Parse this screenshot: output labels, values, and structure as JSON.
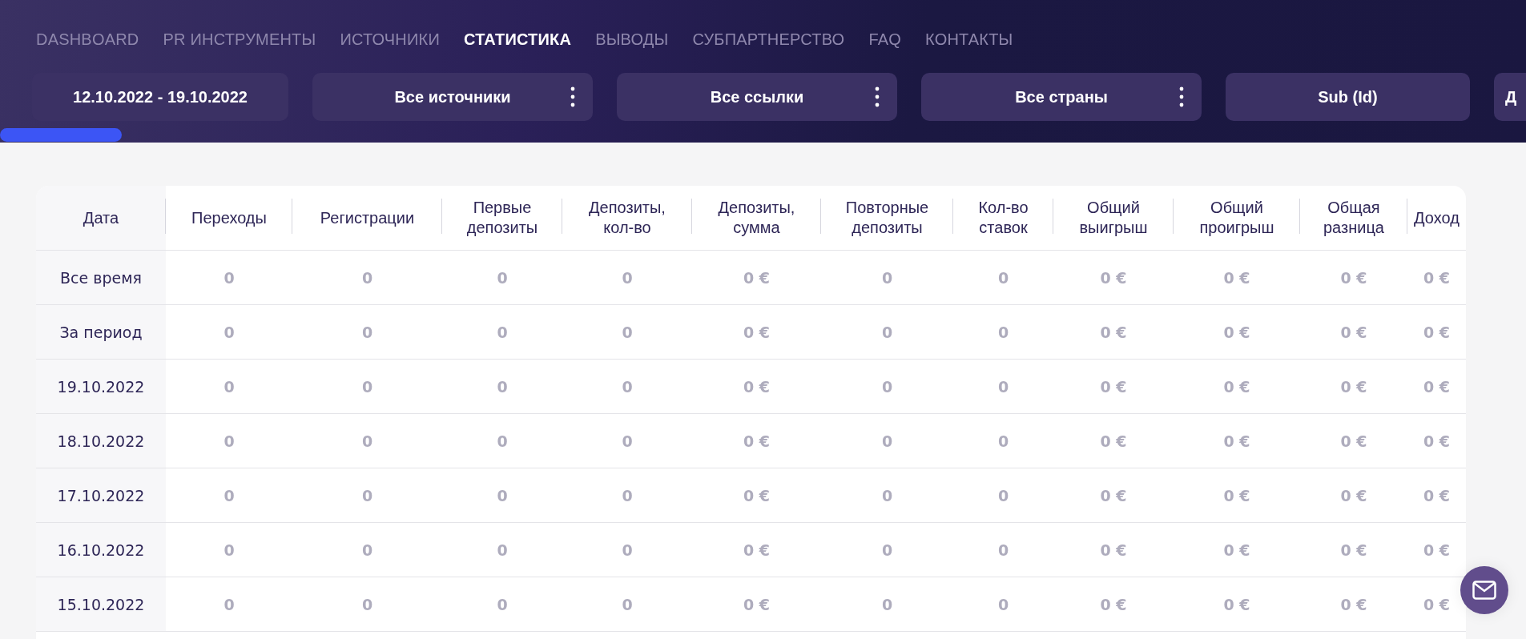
{
  "nav": [
    {
      "label": "DASHBOARD",
      "selected": false
    },
    {
      "label": "PR ИНСТРУМЕНТЫ",
      "selected": false
    },
    {
      "label": "ИСТОЧНИКИ",
      "selected": false
    },
    {
      "label": "СТАТИСТИКА",
      "selected": true
    },
    {
      "label": "ВЫВОДЫ",
      "selected": false
    },
    {
      "label": "СУБПАРТНЕРСТВО",
      "selected": false
    },
    {
      "label": "FAQ",
      "selected": false
    },
    {
      "label": "КОНТАКТЫ",
      "selected": false
    }
  ],
  "filters": [
    {
      "label": "12.10.2022 - 19.10.2022",
      "has_menu": false
    },
    {
      "label": "Все источники",
      "has_menu": true
    },
    {
      "label": "Все ссылки",
      "has_menu": true
    },
    {
      "label": "Все страны",
      "has_menu": true
    },
    {
      "label": "Sub (Id)",
      "has_menu": false
    },
    {
      "label": "Д",
      "has_menu": false
    }
  ],
  "loading": {
    "level": 0.08
  },
  "table": {
    "columns": [
      "Дата",
      "Переходы",
      "Регистрации",
      "Первые депозиты",
      "Депозиты, кол-во",
      "Депозиты, сумма",
      "Повторные депозиты",
      "Кол-во ставок",
      "Общий выигрыш",
      "Общий проигрыш",
      "Общая разница",
      "Доход"
    ],
    "rows": [
      {
        "cells": [
          "Все время",
          "0",
          "0",
          "0",
          "0",
          "0 €",
          "0",
          "0",
          "0 €",
          "0 €",
          "0 €",
          "0 €"
        ]
      },
      {
        "cells": [
          "За период",
          "0",
          "0",
          "0",
          "0",
          "0 €",
          "0",
          "0",
          "0 €",
          "0 €",
          "0 €",
          "0 €"
        ]
      },
      {
        "cells": [
          "19.10.2022",
          "0",
          "0",
          "0",
          "0",
          "0 €",
          "0",
          "0",
          "0 €",
          "0 €",
          "0 €",
          "0 €"
        ]
      },
      {
        "cells": [
          "18.10.2022",
          "0",
          "0",
          "0",
          "0",
          "0 €",
          "0",
          "0",
          "0 €",
          "0 €",
          "0 €",
          "0 €"
        ]
      },
      {
        "cells": [
          "17.10.2022",
          "0",
          "0",
          "0",
          "0",
          "0 €",
          "0",
          "0",
          "0 €",
          "0 €",
          "0 €",
          "0 €"
        ]
      },
      {
        "cells": [
          "16.10.2022",
          "0",
          "0",
          "0",
          "0",
          "0 €",
          "0",
          "0",
          "0 €",
          "0 €",
          "0 €",
          "0 €"
        ]
      },
      {
        "cells": [
          "15.10.2022",
          "0",
          "0",
          "0",
          "0",
          "0 €",
          "0",
          "0",
          "0 €",
          "0 €",
          "0 €",
          "0 €"
        ]
      }
    ]
  }
}
